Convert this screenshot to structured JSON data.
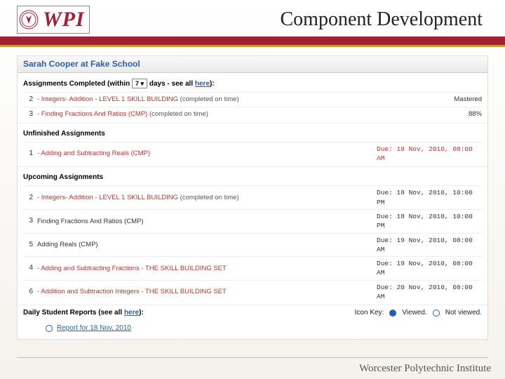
{
  "header": {
    "logo_text": "WPI",
    "title": "Component Development"
  },
  "panel": {
    "student_header": "Sarah Cooper at Fake School",
    "completed": {
      "label_prefix": "Assignments Completed (within",
      "days_value": "7",
      "label_mid": "days - see all",
      "see_all": "here",
      "label_suffix": "):",
      "rows": [
        {
          "n": "2",
          "name": "- Integers- Addition - LEVEL 1 SKILL BUILDING",
          "paren": "(completed on time)",
          "score": "Mastered"
        },
        {
          "n": "3",
          "name": "- Finding Fractions And Ratios (CMP)",
          "paren": "(completed on time)",
          "score": "88%"
        }
      ]
    },
    "unfinished": {
      "title": "Unfinished Assignments",
      "rows": [
        {
          "n": "1",
          "name": "- Adding and Subtracting Reals (CMP)",
          "due": "Due: 18 Nov, 2010, 08:00 AM"
        }
      ]
    },
    "upcoming": {
      "title": "Upcoming Assignments",
      "rows": [
        {
          "n": "2",
          "name": "- Integers- Addition - LEVEL 1 SKILL BUILDING",
          "paren": "(completed on time)",
          "due": "Due: 18 Nov, 2010, 10:00 PM"
        },
        {
          "n": "3",
          "name": "Finding Fractions And Ratios (CMP)",
          "due": "Due: 18 Nov, 2010, 10:00 PM",
          "black": true
        },
        {
          "n": "5",
          "name": "Adding Reals (CMP)",
          "due": "Due: 19 Nov, 2010, 08:00 AM",
          "black": true
        },
        {
          "n": "4",
          "name": "- Adding and Subtracting Fractions - THE SKILL BUILDING SET",
          "due": "Due: 19 Nov, 2010, 08:00 AM"
        },
        {
          "n": "6",
          "name": "- Addition and Subtraction Integers - THE SKILL BUILDING SET",
          "due": "Due: 20 Nov, 2010, 08:00 AM"
        }
      ]
    },
    "reports": {
      "label_prefix": "Daily Student Reports (see all",
      "see_all": "here",
      "label_suffix": "):",
      "icon_key_label": "Icon Key:",
      "viewed": "Viewed.",
      "not_viewed": "Not viewed.",
      "link": "Report for 18 Nov, 2010"
    }
  },
  "footer": "Worcester Polytechnic Institute"
}
